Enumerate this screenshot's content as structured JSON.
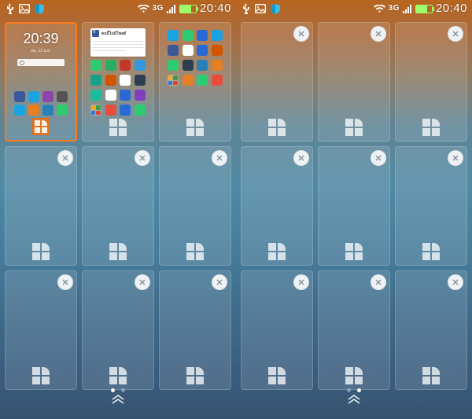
{
  "statusbar": {
    "time": "20:40",
    "network_label": "3G",
    "icons": {
      "usb": "usb-icon",
      "picture": "picture-icon",
      "shield": "shield-icon",
      "wifi": "wifi-icon",
      "signal": "signal-icon",
      "battery": "battery-icon"
    }
  },
  "phones": {
    "A": {
      "pager": {
        "current": 0,
        "total": 2
      },
      "panels": [
        {
          "selected": true,
          "has_close": false,
          "mini": "home1",
          "clock": "20:39",
          "date_line1": "พฤ. 12 ธ.ค.",
          "date_line2": ""
        },
        {
          "selected": false,
          "has_close": false,
          "mini": "home2",
          "card_title": "คนนี้ไม่มีโพสต์"
        },
        {
          "selected": false,
          "has_close": false,
          "mini": "home3"
        },
        {
          "selected": false,
          "has_close": true,
          "mini": "empty"
        },
        {
          "selected": false,
          "has_close": true,
          "mini": "empty"
        },
        {
          "selected": false,
          "has_close": true,
          "mini": "empty"
        },
        {
          "selected": false,
          "has_close": true,
          "mini": "empty"
        },
        {
          "selected": false,
          "has_close": true,
          "mini": "empty"
        },
        {
          "selected": false,
          "has_close": true,
          "mini": "empty"
        }
      ]
    },
    "B": {
      "pager": {
        "current": 1,
        "total": 2
      },
      "panels": [
        {
          "selected": false,
          "has_close": true,
          "mini": "empty"
        },
        {
          "selected": false,
          "has_close": true,
          "mini": "empty"
        },
        {
          "selected": false,
          "has_close": true,
          "mini": "empty"
        },
        {
          "selected": false,
          "has_close": true,
          "mini": "empty"
        },
        {
          "selected": false,
          "has_close": true,
          "mini": "empty"
        },
        {
          "selected": false,
          "has_close": true,
          "mini": "empty"
        },
        {
          "selected": false,
          "has_close": true,
          "mini": "empty"
        },
        {
          "selected": false,
          "has_close": true,
          "mini": "empty"
        },
        {
          "selected": false,
          "has_close": true,
          "mini": "empty"
        }
      ]
    }
  },
  "labels": {
    "close": "✕"
  },
  "mini_home1_apps": [
    "#3b5998",
    "#19a3e1",
    "#8e44ad",
    "#555555",
    "#19a3e1",
    "#e67e22",
    "#2980b9",
    "#2ecc71"
  ],
  "mini_home2_apps": [
    "#2ecc71",
    "#27ae60",
    "#c0392b",
    "#3498db",
    "#16a085",
    "#d35400",
    "#ffffff",
    "#2c3e50",
    "#1abc9c",
    "#ffffff",
    "#2869d6",
    "#7f3fbf",
    "folder",
    "#e74c3c",
    "#2869d6",
    "#2ecc71"
  ],
  "mini_home3_apps": [
    "#19a3e1",
    "#2ecc71",
    "#2869d6",
    "#19a3e1",
    "#3b5998",
    "#ffffff",
    "#2869d6",
    "#d35400",
    "#2ecc71",
    "#2c3e50",
    "#2980b9",
    "#e67e22",
    "folder",
    "#e67e22",
    "#2ecc71",
    "#e74c3c"
  ]
}
